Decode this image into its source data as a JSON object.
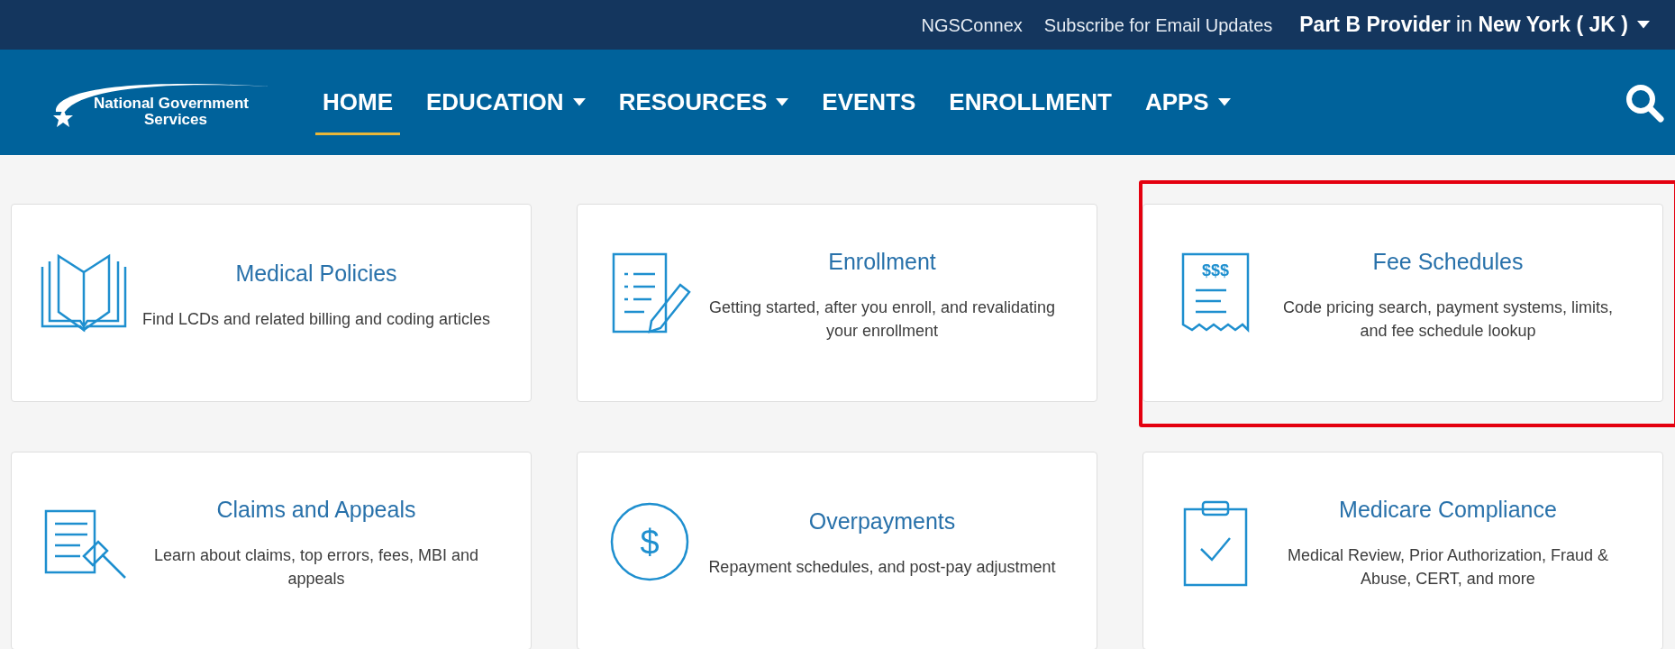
{
  "top_bar": {
    "links": [
      "NGSConnex",
      "Subscribe for Email Updates"
    ],
    "provider_selector": "**Part B Provider** in **New York ( JK )**"
  },
  "logo": {
    "line1": "National Government",
    "line2": "Services"
  },
  "nav": [
    {
      "label": "HOME",
      "selected": true,
      "has_menu": false
    },
    {
      "label": "EDUCATION",
      "selected": false,
      "has_menu": true
    },
    {
      "label": "RESOURCES",
      "selected": false,
      "has_menu": true
    },
    {
      "label": "EVENTS",
      "selected": false,
      "has_menu": false
    },
    {
      "label": "ENROLLMENT",
      "selected": false,
      "has_menu": false
    },
    {
      "label": "APPS",
      "selected": false,
      "has_menu": true
    }
  ],
  "cards": [
    {
      "kind": "book",
      "title": "Medical Policies",
      "description": "Find LCDs and related billing and coding articles",
      "highlighted": false
    },
    {
      "kind": "form",
      "title": "Enrollment",
      "description": "Getting started, after you enroll, and revalidating your enrollment",
      "highlighted": false
    },
    {
      "kind": "receipt",
      "icon_label": "$$$",
      "title": "Fee Schedules",
      "description": "Code pricing search, payment systems, limits, and fee schedule lookup",
      "highlighted": true
    },
    {
      "kind": "gavel",
      "title": "Claims and Appeals",
      "description": "Learn about claims, top errors, fees, MBI and appeals",
      "highlighted": false
    },
    {
      "kind": "coin",
      "icon_label": "$",
      "title": "Overpayments",
      "description": "Repayment schedules, and post-pay adjustment",
      "highlighted": false
    },
    {
      "kind": "clipboard",
      "title": "Medicare Compliance",
      "description": "Medical Review, Prior Authorization, Fraud & Abuse, CERT, and more",
      "highlighted": false
    }
  ]
}
